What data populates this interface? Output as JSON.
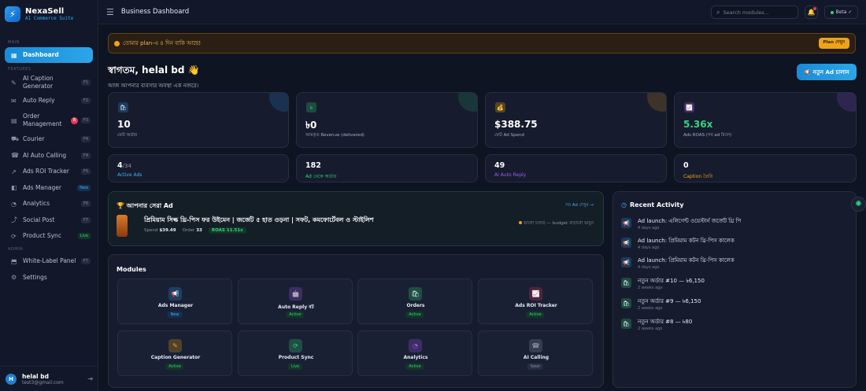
{
  "brand": {
    "name": "NexaSell",
    "tagline": "AI Commerce Suite",
    "logo_icon": "⚡"
  },
  "sidebar": {
    "section_main": "MAIN",
    "section_features": "FEATURES",
    "section_admin": "ADMIN",
    "items": [
      {
        "label": "Dashboard",
        "icon": "▦"
      },
      {
        "label": "AI Caption Generator",
        "icon": "✎",
        "kbd": "F1"
      },
      {
        "label": "Auto Reply",
        "icon": "✉",
        "kbd": "F2"
      },
      {
        "label": "Order Management",
        "icon": "▤",
        "kbd": "F3",
        "badge": "8"
      },
      {
        "label": "Courier",
        "icon": "⛟",
        "kbd": "F4"
      },
      {
        "label": "AI Auto Calling",
        "icon": "☎",
        "kbd": "F4"
      },
      {
        "label": "Ads ROI Tracker",
        "icon": "↗",
        "kbd": "F5"
      },
      {
        "label": "Ads Manager",
        "icon": "◧",
        "kbd": "New"
      },
      {
        "label": "Analytics",
        "icon": "◔",
        "kbd": "F6"
      },
      {
        "label": "Social Post",
        "icon": "⤴",
        "kbd": "F7"
      },
      {
        "label": "Product Sync",
        "icon": "⟳",
        "kbd": "Live"
      },
      {
        "label": "White-Label Panel",
        "icon": "⬒",
        "kbd": "F7"
      },
      {
        "label": "Settings",
        "icon": "⚙"
      }
    ]
  },
  "user": {
    "initial": "H",
    "name": "helal bd",
    "email": "test3@gmail.com"
  },
  "topbar": {
    "title": "Business Dashboard",
    "search_placeholder": "Search modules...",
    "beta": "Beta ✓"
  },
  "alert": {
    "text": "তোমার plan-এ ৪ দিন বাকি আছে!",
    "button": "Plan দেখুন"
  },
  "welcome": {
    "title": "স্বাগতম, helal bd 👋",
    "subtitle": "আজ আপনার ব্যবসার অবস্থা এক নজরে।"
  },
  "campaign_button": "📢 নতুন Ad চালান",
  "stats": [
    {
      "value": "10",
      "label": "মোট অর্ডার",
      "icon": "🛍",
      "color": "#2a9df4"
    },
    {
      "value": "৳0",
      "label": "আয়কৃত Revenue (delivered)",
      "icon": "৳",
      "color": "#2fd67b"
    },
    {
      "value": "$388.75",
      "label": "মোট Ad Spend",
      "icon": "💰",
      "color": "#f0a318"
    },
    {
      "value": "5.36x",
      "label": "Ads ROAS (সব ad মিলে)",
      "icon": "📈",
      "color": "#a259f5",
      "value_color": "#2fd67b"
    }
  ],
  "mini_stats": [
    {
      "value": "4",
      "sub": "/34",
      "label": "Active Ads",
      "color": "#3eb2ff"
    },
    {
      "value": "182",
      "label": "Ad থেকে অর্ডার",
      "color": "#2fd67b"
    },
    {
      "value": "49",
      "label": "AI Auto Reply",
      "color": "#a259f5"
    },
    {
      "value": "0",
      "label": "Caption তৈরি",
      "color": "#f0a318"
    }
  ],
  "best_ad": {
    "heading": "আপনার সেরা Ad",
    "icon": "🏆",
    "link": "সব Ad দেখুন →",
    "title": "প্রিমিয়াম সিল্ক থ্রি-পিস ফর উইমেন | জর্জেট ৫ হাত ওড়না | সফট, কমফোর্টেবল ও স্টাইলিশ",
    "spend_label": "Spend",
    "spend": "$39.49",
    "order_label": "Order",
    "order": "33",
    "roas": "ROAS 11.51x",
    "note": "ভালো চলছে — budget বাড়ানো ভাবুন"
  },
  "modules": {
    "heading": "Modules",
    "items": [
      {
        "name": "Ads Manager",
        "status": "New",
        "icon": "📢",
        "color": "#2a9df4",
        "cls": "new"
      },
      {
        "name": "Auto Reply বট",
        "status": "Active",
        "icon": "🤖",
        "color": "#a259f5",
        "cls": "active"
      },
      {
        "name": "Orders",
        "status": "Active",
        "icon": "🛍",
        "color": "#2fd67b",
        "cls": "active"
      },
      {
        "name": "Ads ROI Tracker",
        "status": "Active",
        "icon": "📈",
        "color": "#e23b5c",
        "cls": "active"
      },
      {
        "name": "Caption Generator",
        "status": "Active",
        "icon": "✎",
        "color": "#f0a318",
        "cls": "active"
      },
      {
        "name": "Product Sync",
        "status": "Live",
        "icon": "⟳",
        "color": "#2fd67b",
        "cls": "live"
      },
      {
        "name": "Analytics",
        "status": "Active",
        "icon": "◔",
        "color": "#a259f5",
        "cls": "active"
      },
      {
        "name": "AI Calling",
        "status": "Soon",
        "icon": "☎",
        "color": "#8b95ab",
        "cls": "soon"
      }
    ]
  },
  "activity": {
    "heading": "Recent Activity",
    "items": [
      {
        "text": "Ad launch: এলিগেন্ট ওয়েস্টার্ন জর্জেট থ্রি পি",
        "when": "4 days ago",
        "icon": "📢",
        "color": "#2a9df4"
      },
      {
        "text": "Ad launch: প্রিমিয়াম কটন থ্রি-পিস কালেক",
        "when": "4 days ago",
        "icon": "📢",
        "color": "#2a9df4"
      },
      {
        "text": "Ad launch: প্রিমিয়াম কটন থ্রি-পিস কালেক",
        "when": "4 days ago",
        "icon": "📢",
        "color": "#2a9df4"
      },
      {
        "text": "নতুন অর্ডার #10 — ৳6,150",
        "when": "2 weeks ago",
        "icon": "🛍",
        "color": "#2fd67b"
      },
      {
        "text": "নতুন অর্ডার #9 — ৳6,150",
        "when": "2 weeks ago",
        "icon": "🛍",
        "color": "#2fd67b"
      },
      {
        "text": "নতুন অর্ডার #8 — ৳80",
        "when": "2 weeks ago",
        "icon": "🛍",
        "color": "#2fd67b"
      }
    ]
  }
}
